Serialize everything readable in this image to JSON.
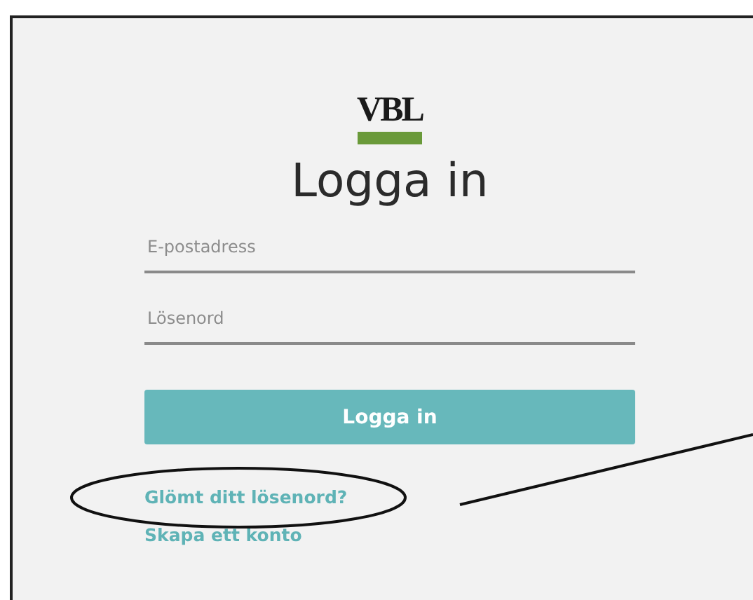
{
  "logo": "VBL",
  "title": "Logga in",
  "fields": [
    {
      "placeholder": "E-postadress"
    },
    {
      "placeholder": "Lösenord"
    }
  ],
  "submit_button": "Logga in",
  "links": [
    "Glömt ditt lösenord?",
    "Skapa ett konto"
  ]
}
